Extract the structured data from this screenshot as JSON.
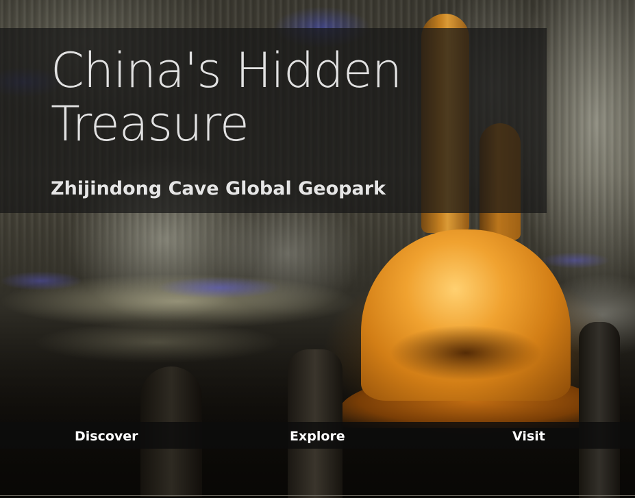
{
  "hero": {
    "title": "China's Hidden Treasure",
    "subtitle": "Zhijindong Cave Global Geopark"
  },
  "nav": {
    "items": [
      {
        "label": "Discover"
      },
      {
        "label": "Explore"
      },
      {
        "label": "Visit"
      }
    ]
  },
  "colors": {
    "panel_overlay": "#161616",
    "title_text": "#e2e2e2",
    "nav_text": "#ffffff",
    "stalagmite_glow": "#f0a230"
  }
}
